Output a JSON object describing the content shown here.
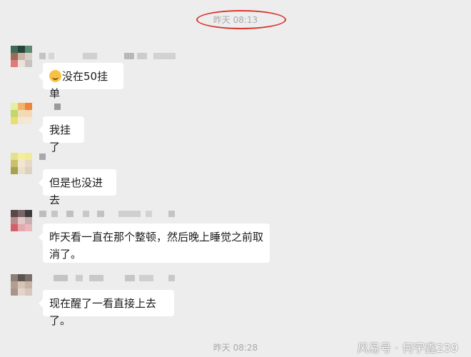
{
  "timestamps": {
    "top": "昨天 08:13",
    "bottom": "昨天 08:28"
  },
  "messages": [
    {
      "text": "没在50挂单",
      "has_emoji": true,
      "emoji": "grinning-sweat-emoji"
    },
    {
      "text": "我挂了"
    },
    {
      "text": "但是也没进去"
    },
    {
      "text": "昨天看一直在那个整顿，然后晚上睡觉之前取消了。"
    },
    {
      "text": "现在醒了一看直接上去了。"
    }
  ],
  "watermark": {
    "text": "风易号 · 何宇鑫239"
  },
  "colors": {
    "background": "#ededed",
    "bubble": "#ffffff",
    "highlight_circle": "#d9382f"
  }
}
